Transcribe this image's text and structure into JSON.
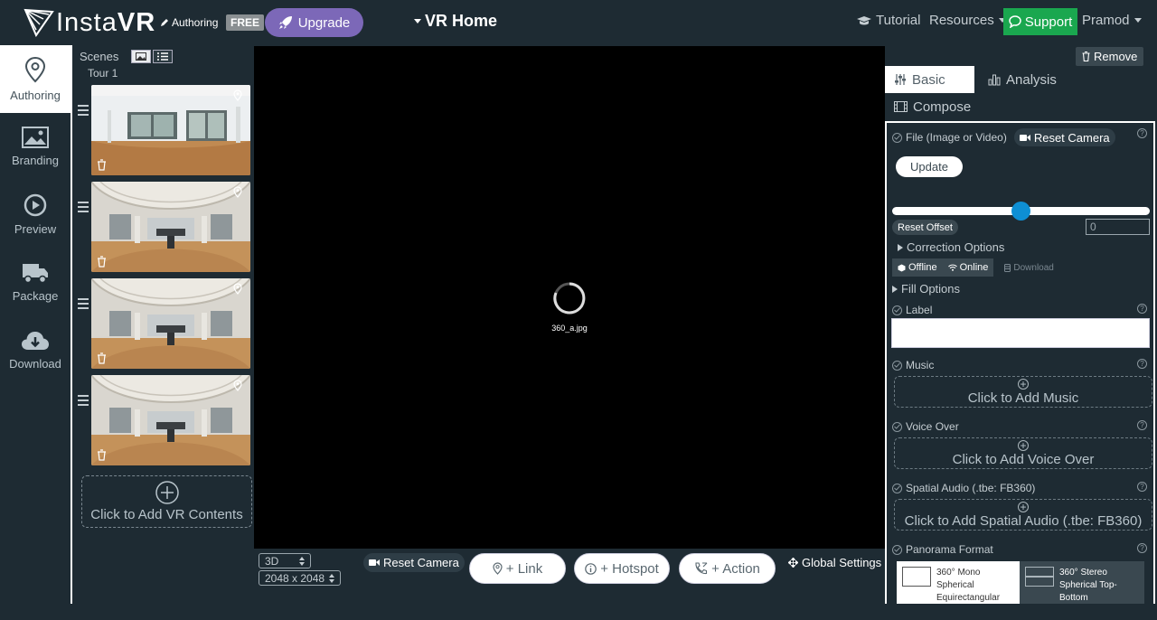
{
  "header": {
    "logo_text_regular": "Insta",
    "logo_text_bold": "VR",
    "authoring_tag": "Authoring",
    "free_badge": "FREE",
    "upgrade_label": "Upgrade",
    "project_title": "VR Home",
    "tutorial_label": "Tutorial",
    "resources_label": "Resources",
    "support_label": "Support",
    "user_label": "Pramod"
  },
  "sidebar": {
    "items": [
      {
        "label": "Authoring",
        "icon": "map-pin-icon",
        "active": true
      },
      {
        "label": "Branding",
        "icon": "image-icon",
        "active": false
      },
      {
        "label": "Preview",
        "icon": "play-circle-icon",
        "active": false
      },
      {
        "label": "Package",
        "icon": "truck-icon",
        "active": false
      },
      {
        "label": "Download",
        "icon": "cloud-download-icon",
        "active": false
      }
    ]
  },
  "scenes": {
    "title": "Scenes",
    "tour_label": "Tour 1",
    "add_label": "Click to Add VR Contents"
  },
  "viewer": {
    "loading_file": "360_a.jpg"
  },
  "bottombar": {
    "mode_value": "3D",
    "resolution_value": "2048 x 2048",
    "reset_camera": "Reset Camera",
    "link_label": "+ Link",
    "hotspot_label": "+ Hotspot",
    "action_label": "+ Action",
    "global_settings": "Global Settings"
  },
  "panel": {
    "remove_label": "Remove",
    "tabs": {
      "basic": "Basic",
      "analysis": "Analysis",
      "compose": "Compose"
    },
    "file_label": "File (Image or Video)",
    "reset_camera": "Reset Camera",
    "update_label": "Update",
    "offset_value": "0",
    "offset_fraction": 0.5,
    "reset_offset": "Reset Offset",
    "correction_options": "Correction Options",
    "offline_label": "Offline",
    "online_label": "Online",
    "download_label": "Download",
    "fill_options": "Fill Options",
    "label_title": "Label",
    "music_title": "Music",
    "music_add": "Click to Add Music",
    "voice_title": "Voice Over",
    "voice_add": "Click to Add Voice Over",
    "spatial_title": "Spatial Audio (.tbe: FB360)",
    "spatial_add": "Click to Add Spatial Audio (.tbe: FB360)",
    "panorama_title": "Panorama Format",
    "formats": [
      {
        "label": "360° Mono Spherical Equirectangular",
        "selected": true
      },
      {
        "label": "360° Stereo Spherical Top-Bottom",
        "selected": false
      }
    ]
  },
  "colors": {
    "background": "#1e2b33",
    "accent_upgrade": "#7c68b8",
    "support_green": "#1aa74f",
    "slider_knob": "#0e8fd4"
  }
}
